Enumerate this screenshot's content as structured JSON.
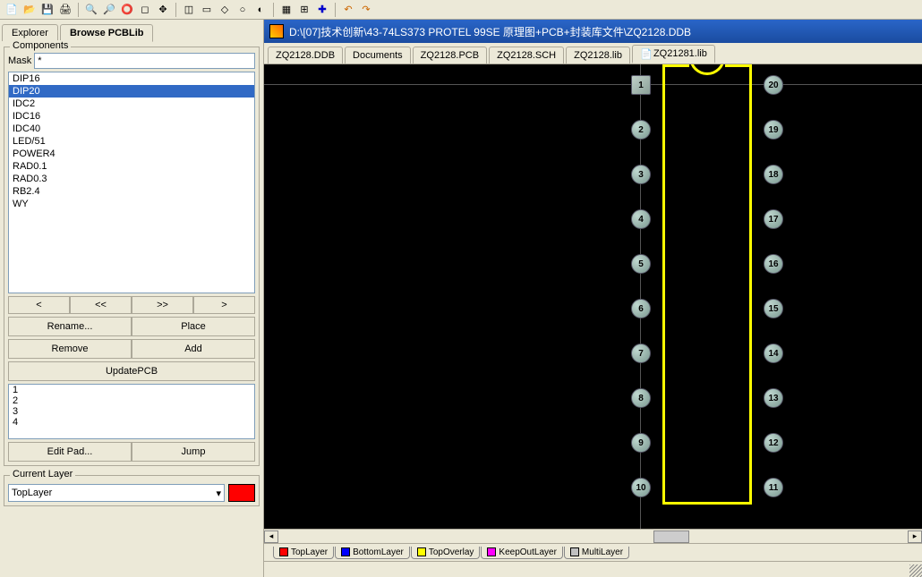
{
  "toolbar_icons": [
    "new",
    "open",
    "save",
    "print",
    "sep",
    "zoom-in",
    "zoom-out",
    "zoom-fit",
    "zoom-area",
    "pan",
    "sep",
    "select",
    "line",
    "pad",
    "via",
    "arc",
    "sep",
    "grid",
    "snap",
    "sep",
    "undo",
    "redo",
    "cross"
  ],
  "left_tabs": {
    "explorer": "Explorer",
    "browse": "Browse PCBLib"
  },
  "components": {
    "title": "Components",
    "mask_label": "Mask",
    "mask_value": "*",
    "items": [
      "DIP16",
      "DIP20",
      "IDC2",
      "IDC16",
      "IDC40",
      "LED/51",
      "POWER4",
      "RAD0.1",
      "RAD0.3",
      "RB2.4",
      "WY"
    ],
    "selected": "DIP20",
    "nav": {
      "first": "<",
      "prev": "<<",
      "next": ">>",
      "last": ">"
    },
    "rename": "Rename...",
    "place": "Place",
    "remove": "Remove",
    "add": "Add",
    "update": "UpdatePCB",
    "pads": [
      "1",
      "2",
      "3",
      "4"
    ],
    "edit_pad": "Edit Pad...",
    "jump": "Jump"
  },
  "current_layer": {
    "title": "Current Layer",
    "value": "TopLayer",
    "color": "#ff0000"
  },
  "window_title": "D:\\[07]技术创新\\43-74LS373 PROTEL 99SE 原理图+PCB+封装库文件\\ZQ2128.DDB",
  "doc_tabs": [
    "ZQ2128.DDB",
    "Documents",
    "ZQ2128.PCB",
    "ZQ2128.SCH",
    "ZQ2128.lib",
    "ZQ21281.lib"
  ],
  "doc_tab_active": "ZQ21281.lib",
  "footprint": {
    "name": "DIP20",
    "left_pads": [
      1,
      2,
      3,
      4,
      5,
      6,
      7,
      8,
      9,
      10
    ],
    "right_pads": [
      20,
      19,
      18,
      17,
      16,
      15,
      14,
      13,
      12,
      11
    ]
  },
  "layer_tabs": [
    {
      "label": "TopLayer",
      "cls": "lt-red"
    },
    {
      "label": "BottomLayer",
      "cls": "lt-blue"
    },
    {
      "label": "TopOverlay",
      "cls": "lt-yellow"
    },
    {
      "label": "KeepOutLayer",
      "cls": "lt-magenta"
    },
    {
      "label": "MultiLayer",
      "cls": "lt-gray"
    }
  ]
}
